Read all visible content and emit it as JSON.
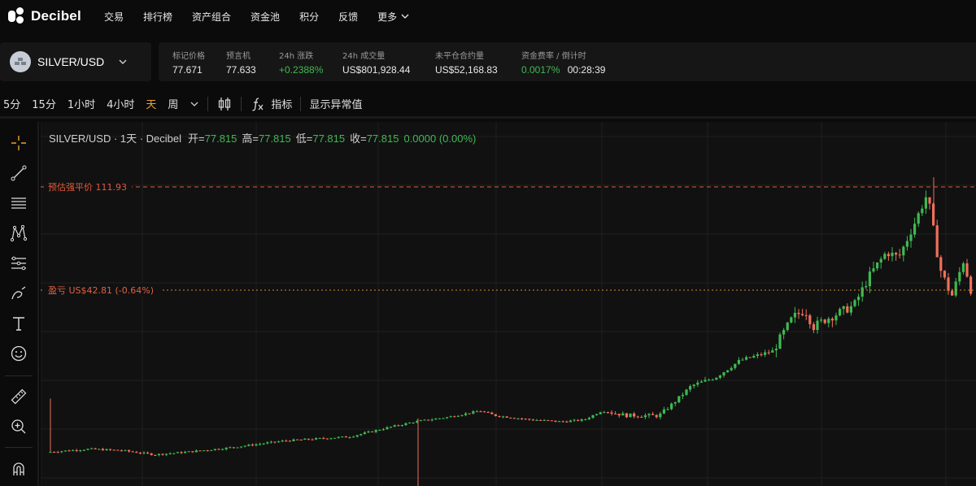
{
  "app": {
    "logo_text": "Decibel"
  },
  "nav": {
    "items": [
      "交易",
      "排行榜",
      "资产组合",
      "资金池",
      "积分",
      "反馈"
    ],
    "more_label": "更多"
  },
  "market": {
    "pair": "SILVER/USD",
    "stats": [
      {
        "label": "标记价格",
        "value": "77.671",
        "color": "#e8e8e8"
      },
      {
        "label": "预言机",
        "value": "77.633",
        "color": "#e8e8e8"
      },
      {
        "label": "24h 涨跌",
        "value": "+0.2388%",
        "color": "#3fb950"
      },
      {
        "label": "24h 成交量",
        "value": "US$801,928.44",
        "color": "#e8e8e8"
      },
      {
        "label": "未平仓合约量",
        "value": "US$52,168.83",
        "color": "#e8e8e8"
      },
      {
        "label": "资金费率 / 倒计时",
        "value": "0.0017%",
        "value2": "00:28:39",
        "color": "#3fb950"
      }
    ]
  },
  "toolbar": {
    "timeframes": [
      "5分",
      "15分",
      "1小时",
      "4小时",
      "天",
      "周"
    ],
    "active_timeframe": "天",
    "indicators_label": "指标",
    "outliers_label": "显示异常值"
  },
  "chart_legend": {
    "title": "SILVER/USD · 1天 · Decibel",
    "open_label": "开=",
    "open": "77.815",
    "high_label": "高=",
    "high": "77.815",
    "low_label": "低=",
    "low": "77.815",
    "close_label": "收=",
    "close": "77.815",
    "change": "0.0000 (0.00%)"
  },
  "price_lines": {
    "liquidation_label": "预估强平价 111.93",
    "pnl_label": "盈亏 US$42.81 (-0.64%)"
  },
  "colors": {
    "up": "#3fb950",
    "down": "#f0705a",
    "accent": "#f0a030",
    "liquidation": "#e05a3a",
    "pnl": "#d9882a"
  },
  "tools": [
    "crosshair-icon",
    "trend-line-icon",
    "horizontal-lines-icon",
    "pattern-icon",
    "fib-icon",
    "brush-icon",
    "text-icon",
    "emoji-icon",
    "ruler-icon",
    "zoom-icon",
    "magnet-icon"
  ],
  "chart_data": {
    "type": "candlestick",
    "title": "SILVER/USD · 1天 · Decibel",
    "liquidation_price": 111.93,
    "last": 77.815,
    "candles": []
  }
}
